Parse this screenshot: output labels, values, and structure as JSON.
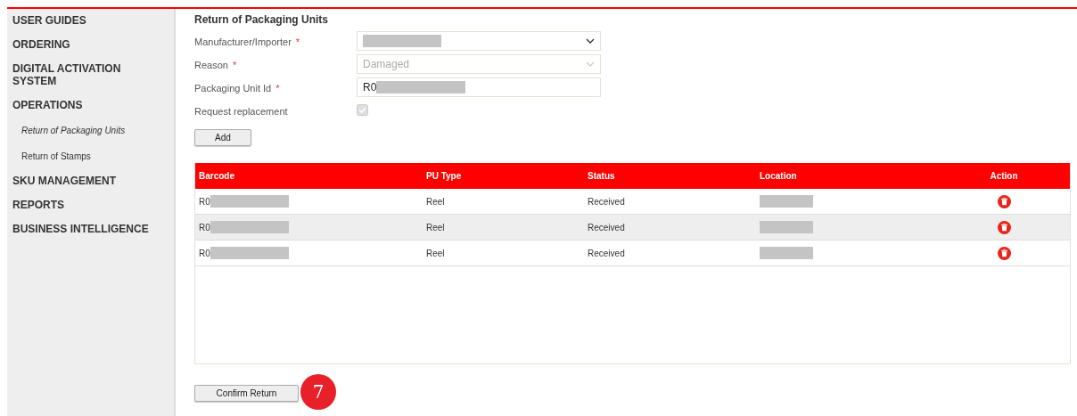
{
  "sidebar": {
    "items": [
      {
        "label": "USER GUIDES"
      },
      {
        "label": "ORDERING"
      },
      {
        "label": "DIGITAL ACTIVATION SYSTEM"
      },
      {
        "label": "OPERATIONS",
        "children": [
          {
            "label": "Return of Packaging Units",
            "selected": true
          },
          {
            "label": "Return of Stamps",
            "selected": false
          }
        ]
      },
      {
        "label": "SKU MANAGEMENT"
      },
      {
        "label": "REPORTS"
      },
      {
        "label": "BUSINESS INTELLIGENCE"
      }
    ]
  },
  "form": {
    "title": "Return of Packaging Units",
    "fields": [
      {
        "kind": "select",
        "label": "Manufacturer/Importer",
        "required_mark": "*",
        "redacted": true
      },
      {
        "kind": "select",
        "label": "Reason",
        "required_mark": "*",
        "disabled": true,
        "value": "Damaged"
      },
      {
        "kind": "text",
        "label": "Packaging Unit Id",
        "required_mark": "*",
        "value": "R0",
        "redacted": true
      },
      {
        "kind": "checkbox",
        "label": "Request replacement",
        "disabled": true,
        "checked": true
      }
    ],
    "add_button": "Add"
  },
  "table": {
    "columns": [
      "Barcode",
      "PU Type",
      "Status",
      "Location",
      "Action"
    ],
    "rows": [
      {
        "barcode": "R0",
        "pu_type": "Reel",
        "status": "Received"
      },
      {
        "barcode": "R0",
        "pu_type": "Reel",
        "status": "Received"
      },
      {
        "barcode": "R0",
        "pu_type": "Reel",
        "status": "Received"
      }
    ]
  },
  "confirm_button": "Confirm Return",
  "step_badge": "7"
}
